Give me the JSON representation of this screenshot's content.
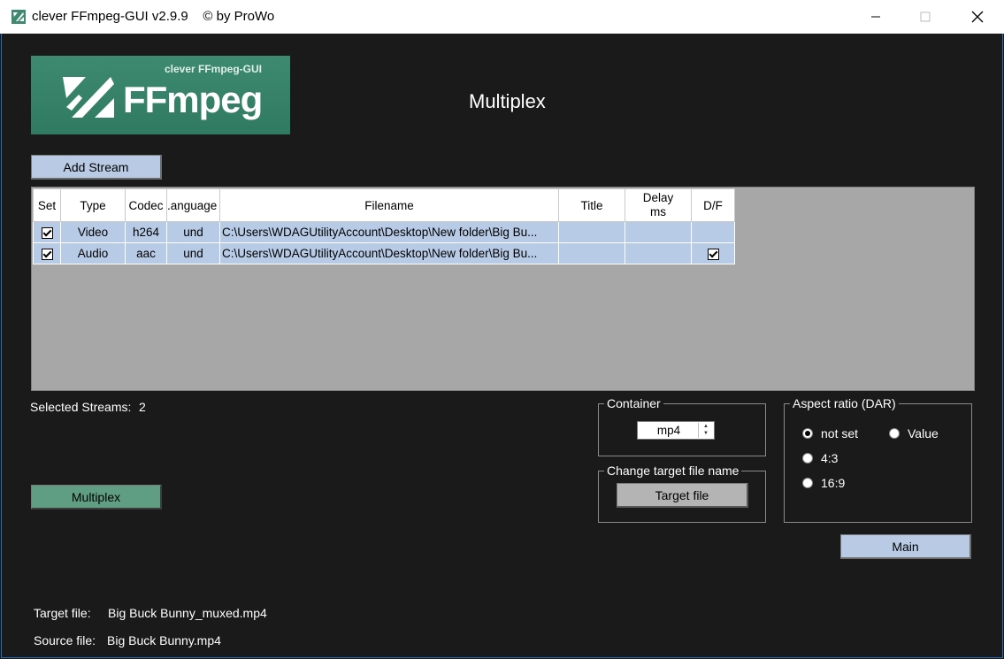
{
  "window": {
    "title": "clever FFmpeg-GUI v2.9.9    © by ProWo",
    "minimize_icon": "minimize-icon",
    "maximize_icon": "maximize-icon",
    "close_icon": "close-icon"
  },
  "logo": {
    "small_text": "clever FFmpeg-GUI",
    "big_text": "FFmpeg"
  },
  "heading": "Multiplex",
  "buttons": {
    "add_stream": "Add Stream",
    "multiplex": "Multiplex",
    "target_file": "Target file",
    "main": "Main"
  },
  "table": {
    "headers": {
      "set": "Set",
      "type": "Type",
      "codec": "Codec",
      "language": ".anguage",
      "filename": "Filename",
      "title": "Title",
      "delay_line1": "Delay",
      "delay_line2": "ms",
      "df": "D/F"
    },
    "rows": [
      {
        "set": true,
        "type": "Video",
        "codec": "h264",
        "language": "und",
        "filename": "C:\\Users\\WDAGUtilityAccount\\Desktop\\New folder\\Big Bu...",
        "title": "",
        "delay": "",
        "df": false
      },
      {
        "set": true,
        "type": "Audio",
        "codec": "aac",
        "language": "und",
        "filename": "C:\\Users\\WDAGUtilityAccount\\Desktop\\New folder\\Big Bu...",
        "title": "",
        "delay": "",
        "df": true
      }
    ]
  },
  "selected_streams": {
    "label": "Selected Streams:",
    "count": "2"
  },
  "container": {
    "legend": "Container",
    "value": "mp4"
  },
  "change_target": {
    "legend": "Change target file name"
  },
  "aspect_ratio": {
    "legend": "Aspect ratio (DAR)",
    "options": [
      {
        "label": "not set",
        "selected": true
      },
      {
        "label": "Value",
        "selected": false
      },
      {
        "label": "4:3",
        "selected": false
      },
      {
        "label": "16:9",
        "selected": false
      }
    ]
  },
  "files": {
    "target_label": "Target file:",
    "target_value": "Big Buck Bunny_muxed.mp4",
    "source_label": "Source file:",
    "source_value": "Big Buck Bunny.mp4"
  },
  "colors": {
    "accent_green": "#5f9e83",
    "accent_blue": "#b9cbe4",
    "background": "#1a1a1a"
  }
}
